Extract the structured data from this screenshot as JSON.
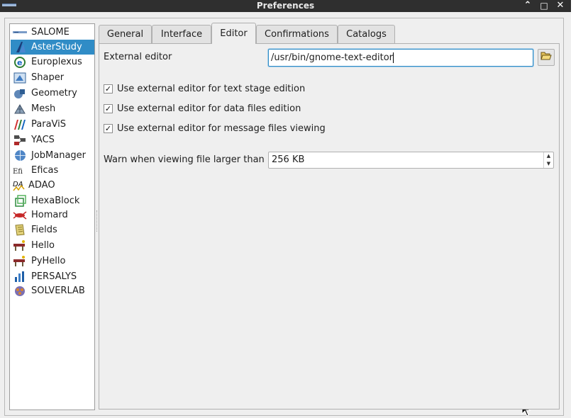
{
  "window": {
    "title": "Preferences"
  },
  "modules": [
    {
      "label": "SALOME",
      "icon": "salome-icon",
      "selected": false
    },
    {
      "label": "AsterStudy",
      "icon": "asterstudy-icon",
      "selected": true
    },
    {
      "label": "Europlexus",
      "icon": "europlexus-icon",
      "selected": false
    },
    {
      "label": "Shaper",
      "icon": "shaper-icon",
      "selected": false
    },
    {
      "label": "Geometry",
      "icon": "geometry-icon",
      "selected": false
    },
    {
      "label": "Mesh",
      "icon": "mesh-icon",
      "selected": false
    },
    {
      "label": "ParaViS",
      "icon": "paravis-icon",
      "selected": false
    },
    {
      "label": "YACS",
      "icon": "yacs-icon",
      "selected": false
    },
    {
      "label": "JobManager",
      "icon": "jobmanager-icon",
      "selected": false
    },
    {
      "label": "Eficas",
      "icon": "eficas-icon",
      "selected": false
    },
    {
      "label": "ADAO",
      "icon": "adao-icon",
      "selected": false
    },
    {
      "label": "HexaBlock",
      "icon": "hexablock-icon",
      "selected": false
    },
    {
      "label": "Homard",
      "icon": "homard-icon",
      "selected": false
    },
    {
      "label": "Fields",
      "icon": "fields-icon",
      "selected": false
    },
    {
      "label": "Hello",
      "icon": "hello-icon",
      "selected": false
    },
    {
      "label": "PyHello",
      "icon": "pyhello-icon",
      "selected": false
    },
    {
      "label": "PERSALYS",
      "icon": "persalys-icon",
      "selected": false
    },
    {
      "label": "SOLVERLAB",
      "icon": "solverlab-icon",
      "selected": false
    }
  ],
  "tabs": [
    {
      "label": "General",
      "active": false
    },
    {
      "label": "Interface",
      "active": false
    },
    {
      "label": "Editor",
      "active": true
    },
    {
      "label": "Confirmations",
      "active": false
    },
    {
      "label": "Catalogs",
      "active": false
    }
  ],
  "editor": {
    "external_editor_label": "External editor",
    "external_editor_value": "/usr/bin/gnome-text-editor",
    "checkboxes": [
      {
        "label": "Use external editor for text stage edition",
        "checked": true
      },
      {
        "label": "Use external editor for data files edition",
        "checked": true
      },
      {
        "label": "Use external editor for message files viewing",
        "checked": true
      }
    ],
    "warn_label": "Warn when viewing file larger than",
    "warn_value": "256 KB"
  },
  "glyphs": {
    "checkmark": "✓",
    "up": "▲",
    "down": "▼",
    "minimize": "⌃",
    "maximize": "□",
    "close": "✕"
  },
  "colors": {
    "selection": "#308cc6",
    "titlebar": "#2f2f2f",
    "background": "#efefef"
  }
}
